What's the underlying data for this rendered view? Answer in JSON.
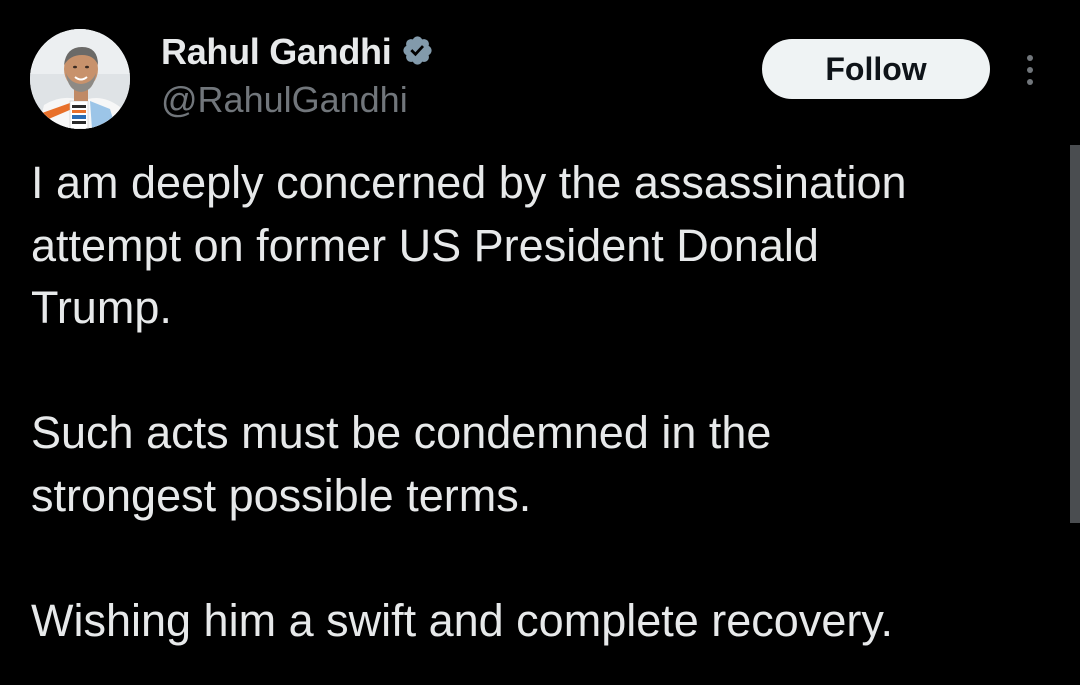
{
  "author": {
    "display_name": "Rahul Gandhi",
    "handle": "@RahulGandhi",
    "verified": true,
    "verified_badge_icon": "verified-badge-icon",
    "avatar_icon": "profile-photo"
  },
  "actions": {
    "follow_label": "Follow",
    "more_icon": "more-options-vertical-icon"
  },
  "tweet": {
    "paragraphs": [
      "I am deeply concerned by the assassination\nattempt on former US President Donald\nTrump.",
      "Such acts must be condemned in the\nstrongest possible terms.",
      "Wishing him a swift and complete recovery."
    ]
  },
  "colors": {
    "background": "#000000",
    "text_primary": "#e7e9ea",
    "text_secondary": "#71767b",
    "follow_button_bg": "#eff3f4",
    "follow_button_text": "#0f1419",
    "scrollbar": "#4a4d50"
  }
}
